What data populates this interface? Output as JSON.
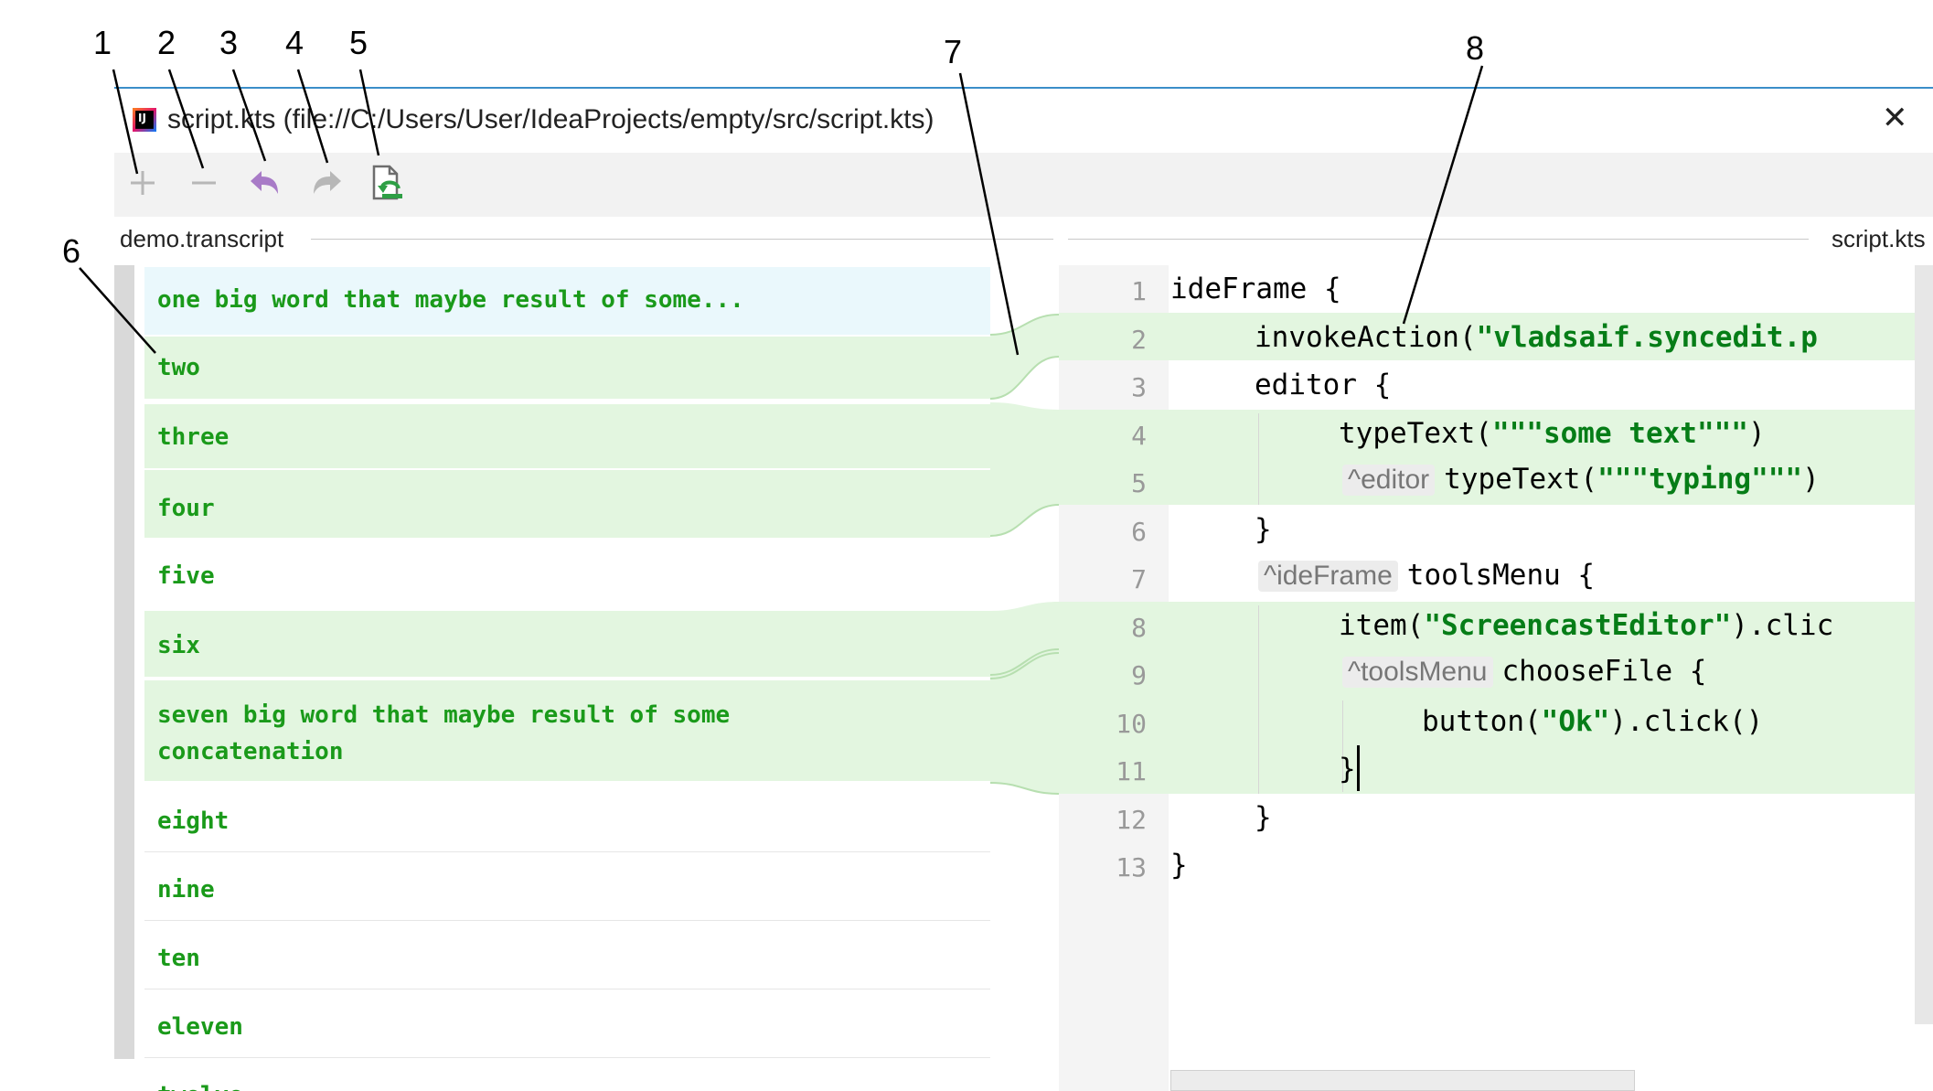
{
  "callouts": [
    "1",
    "2",
    "3",
    "4",
    "5",
    "6",
    "7",
    "8"
  ],
  "window": {
    "title": "script.kts (file://C:/Users/User/IdeaProjects/empty/src/script.kts)",
    "close_glyph": "✕"
  },
  "toolbar": {
    "buttons": [
      {
        "name": "add",
        "icon": "plus-icon",
        "enabled": false
      },
      {
        "name": "remove",
        "icon": "minus-icon",
        "enabled": false
      },
      {
        "name": "undo",
        "icon": "undo-arrow-icon",
        "enabled": true,
        "color": "#a87bc7"
      },
      {
        "name": "redo",
        "icon": "redo-arrow-icon",
        "enabled": false
      },
      {
        "name": "reload",
        "icon": "reload-file-icon",
        "enabled": true,
        "color": "#2e9f45"
      }
    ]
  },
  "left_panel": {
    "title": "demo.transcript",
    "items": [
      "one big word that maybe result of some...",
      "two",
      "three",
      "four",
      "five",
      "six",
      "seven big word that maybe result of some concatenation",
      "eight",
      "nine",
      "ten",
      "eleven",
      "twelve"
    ]
  },
  "right_panel": {
    "title": "script.kts",
    "line_numbers": [
      "1",
      "2",
      "3",
      "4",
      "5",
      "6",
      "7",
      "8",
      "9",
      "10",
      "11",
      "12",
      "13"
    ],
    "code": {
      "l1": "ideFrame {",
      "l2_pre": "invokeAction(",
      "l2_str": "\"vladsaif.syncedit.p",
      "l3": "editor {",
      "l4_pre": "typeText(",
      "l4_str": "\"\"\"some text\"\"\"",
      "l4_post": ")",
      "l5_hint": "^editor",
      "l5_pre": "typeText(",
      "l5_str": "\"\"\"typing\"\"\"",
      "l5_post": ")",
      "l6": "}",
      "l7_hint": "^ideFrame",
      "l7": "toolsMenu {",
      "l8_pre": "item(",
      "l8_str": "\"ScreencastEditor\"",
      "l8_post": ").clic",
      "l9_hint": "^toolsMenu",
      "l9": "chooseFile {",
      "l10_pre": "button(",
      "l10_str": "\"Ok\"",
      "l10_post": ").click()",
      "l11": "}",
      "l12": "}",
      "l13": "}"
    }
  },
  "colors": {
    "diff_green": "#e3f6e0",
    "selected_blue": "#eaf8fc",
    "text_green": "#1a9a1a",
    "accent_line": "#3b8ec9"
  }
}
